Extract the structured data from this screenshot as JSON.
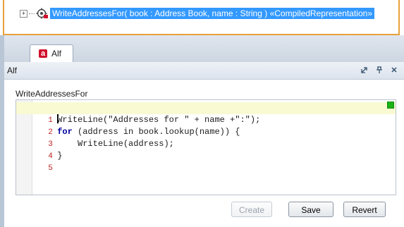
{
  "tree": {
    "expander_symbol": "+",
    "operation_icon": "operation-settings-icon",
    "operation_label": "WriteAddressesFor( book : Address Book, name : String ) «CompiledRepresentation»"
  },
  "tabs": [
    {
      "label": "Alf",
      "icon": "alf-icon",
      "icon_letter": "a"
    }
  ],
  "panel": {
    "title": "Alf",
    "controls": {
      "restore": "restore-icon",
      "pin": "pin-icon",
      "close": "close-icon"
    }
  },
  "editor": {
    "function_name": "WriteAddressesFor",
    "line_numbers": [
      "1",
      "2",
      "3",
      "4",
      "5"
    ],
    "current_line": 1,
    "lines": [
      "WriteLine(\"Addresses for \" + name +\":\");",
      "for (address in book.lookup(name)) {",
      "    WriteLine(address);",
      "}",
      ""
    ],
    "status_color": "#19b219"
  },
  "buttons": {
    "create": "Create",
    "save": "Save",
    "revert": "Revert"
  },
  "colors": {
    "selection": "#3399ff",
    "tree_border": "#e8a13c",
    "keyword": "#0000a0"
  }
}
